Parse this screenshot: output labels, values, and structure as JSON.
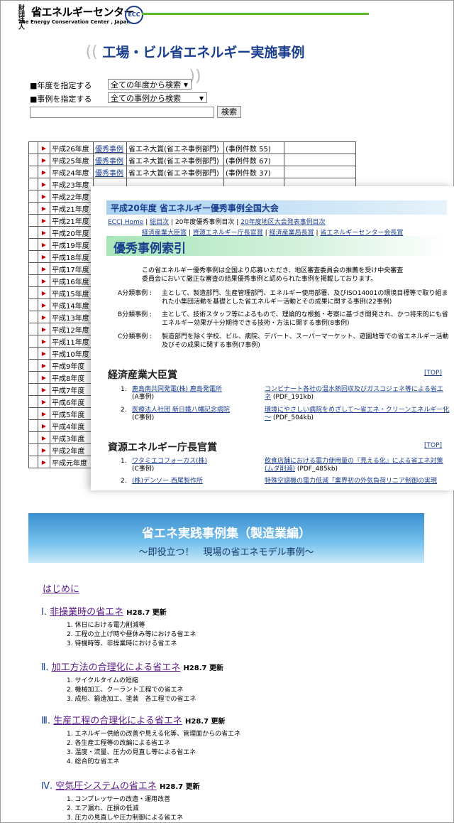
{
  "header": {
    "logo_small": "財団法人",
    "logo_main": "省エネルギーセンター",
    "logo_sub": "The Energy Conservation Center , Japan",
    "logo_badge": "ECC"
  },
  "page_title": "工場・ビル省エネルギー実施事例",
  "filters": {
    "year_label": "■年度を指定する",
    "year_value": "全ての年度から検索",
    "case_label": "■事例を指定する",
    "case_value": "全ての事例から検索",
    "search_button": "検索"
  },
  "years": [
    {
      "year": "平成26年度",
      "link": "優秀事例",
      "award": "省エネ大賞(省エネ事例部門)",
      "count": "(事例件数 55)"
    },
    {
      "year": "平成25年度",
      "link": "優秀事例",
      "award": "省エネ大賞(省エネ事例部門)",
      "count": "(事例件数 67)"
    },
    {
      "year": "平成24年度",
      "link": "優秀事例",
      "award": "省エネ大賞(省エネ事例部門)",
      "count": "(事例件数 37)"
    },
    {
      "year": "平成23年度"
    },
    {
      "year": "平成22年度"
    },
    {
      "year": "平成21年度"
    },
    {
      "year": "平成21年度"
    },
    {
      "year": "平成20年度"
    },
    {
      "year": "平成19年度"
    },
    {
      "year": "平成18年度"
    },
    {
      "year": "平成17年度"
    },
    {
      "year": "平成16年度"
    },
    {
      "year": "平成15年度"
    },
    {
      "year": "平成14年度"
    },
    {
      "year": "平成13年度"
    },
    {
      "year": "平成12年度"
    },
    {
      "year": "平成11年度"
    },
    {
      "year": "平成10年度"
    },
    {
      "year": "平成9年度"
    },
    {
      "year": "平成8年度"
    },
    {
      "year": "平成7年度"
    },
    {
      "year": "平成6年度"
    },
    {
      "year": "平成5年度"
    },
    {
      "year": "平成4年度"
    },
    {
      "year": "平成3年度"
    },
    {
      "year": "平成2年度"
    },
    {
      "year": "平成元年度"
    }
  ],
  "overlay2": {
    "banner": "平成20年度 省エネルギー優秀事例全国大会",
    "nav1": [
      "ECCJ Home",
      "総目次",
      "20年度優秀事例目次",
      "20年度地区大会発表事例目次"
    ],
    "nav2": [
      "経済産業大臣賞",
      "資源エネルギー庁長官賞",
      "経済産業局長賞",
      "省エネルギーセンター会長賞"
    ],
    "section": "優秀事例索引",
    "intro1": "この省エネルギー優秀事例は全国より応募いただき、地区審査委員会の推薦を受け中央審査",
    "intro2": "委員会において厳正な審査の結果優秀事例と認められた事例を掲載しております。",
    "a_label": "A分類事例 :",
    "a1": "主として、製造部門、生産管理部門、エネルギー使用部署、及びISO14001の環境目標等で取り組ま",
    "a2": "れた小集団活動を基礎とした省エネルギー活動とその成果に関する事例(22事例)",
    "b_label": "B分類事例 :",
    "b1": "主として、技術スタッフ等によるもので、理論的な根拠・考察に基づき開発され、かつ将来的にも省",
    "b2": "エネルギー効果が十分期待できる技術・方法に関する事例(8事例)",
    "c_label": "C分類事例 :",
    "c1": "製造部門を除く学校、ビル、病院、デパート、スーパーマーケット、遊園地等での省エネルギー活動",
    "c2": "及びその成果に関する事例(7事例)",
    "h1": "経済産業大臣賞",
    "top": "[TOP]",
    "l1a": "鹿島南共同発電(株) 鹿島発電所",
    "l1b": "(A事例)",
    "l1c": "コンビナート各社の温水熱回収及びガスコジェネ等による省エ",
    "l1d": "ネ",
    "l1e": "(PDF_191kb)",
    "l2a": "医療法人社団 新日鐵八幡記念病院",
    "l2b": "(C事例)",
    "l2c": "環境にやさしい病院をめざして〜省エネ・クリーンエネルギー化",
    "l2d": "〜",
    "l2e": "(PDF_504kb)",
    "h2": "資源エネルギー庁長官賞",
    "l3a": "ワタミエコフォーカス(株)",
    "l3b": "(C事例)",
    "l3c": "飲食店舗における電力使用量の『見える化』による省エネ対策",
    "l3d": "(ムダ削減)",
    "l3e": "(PDF_485kb)",
    "l4a": "(株)デンソー 西尾製作所",
    "l4c": "特殊空調機の電力低減「業界初の外気負荷リニア制御の実現",
    "n1": "1.",
    "n2": "2."
  },
  "manual": {
    "banner_title": "省エネ実践事例集（製造業編）",
    "banner_sub": "〜即役立つ！　現場の省エネモデル事例〜",
    "intro": "はじめに",
    "sections": [
      {
        "num": "Ⅰ.",
        "title": "非操業時の省エネ",
        "date": "H28.7 更新",
        "items": [
          "1. 休日における電力削減等",
          "2. 工程の立上げ時や昼休み等における省エネ",
          "3. 待機時等、非操業時における省エネ"
        ]
      },
      {
        "num": "Ⅱ.",
        "title": "加工方法の合理化による省エネ",
        "date": "H28.7 更新",
        "items": [
          "1. サイクルタイムの短縮",
          "2. 機械加工、クーラント工程での省エネ",
          "3. 成形、鍛造加工、塗装　各工程での省エネ"
        ]
      },
      {
        "num": "Ⅲ.",
        "title": "生産工程の合理化による省エネ",
        "date": "H28.7 更新",
        "items": [
          "1. エネルギー供給の改善や見える化等、管理面からの省エネ",
          "2. 各生産工程等の改編による省エネ",
          "3. 温度・流量、圧力の見直し等による省エネ",
          "4. 総合的な省エネ"
        ]
      },
      {
        "num": "Ⅳ.",
        "title": "空気圧システムの省エネ",
        "date": "H28.7 更新",
        "items": [
          "1. コンプレッサーの改造・運用改善",
          "2. エア漏れ、圧損の低減",
          "3. 圧力の見直しや圧力制御による省エネ"
        ]
      }
    ]
  }
}
